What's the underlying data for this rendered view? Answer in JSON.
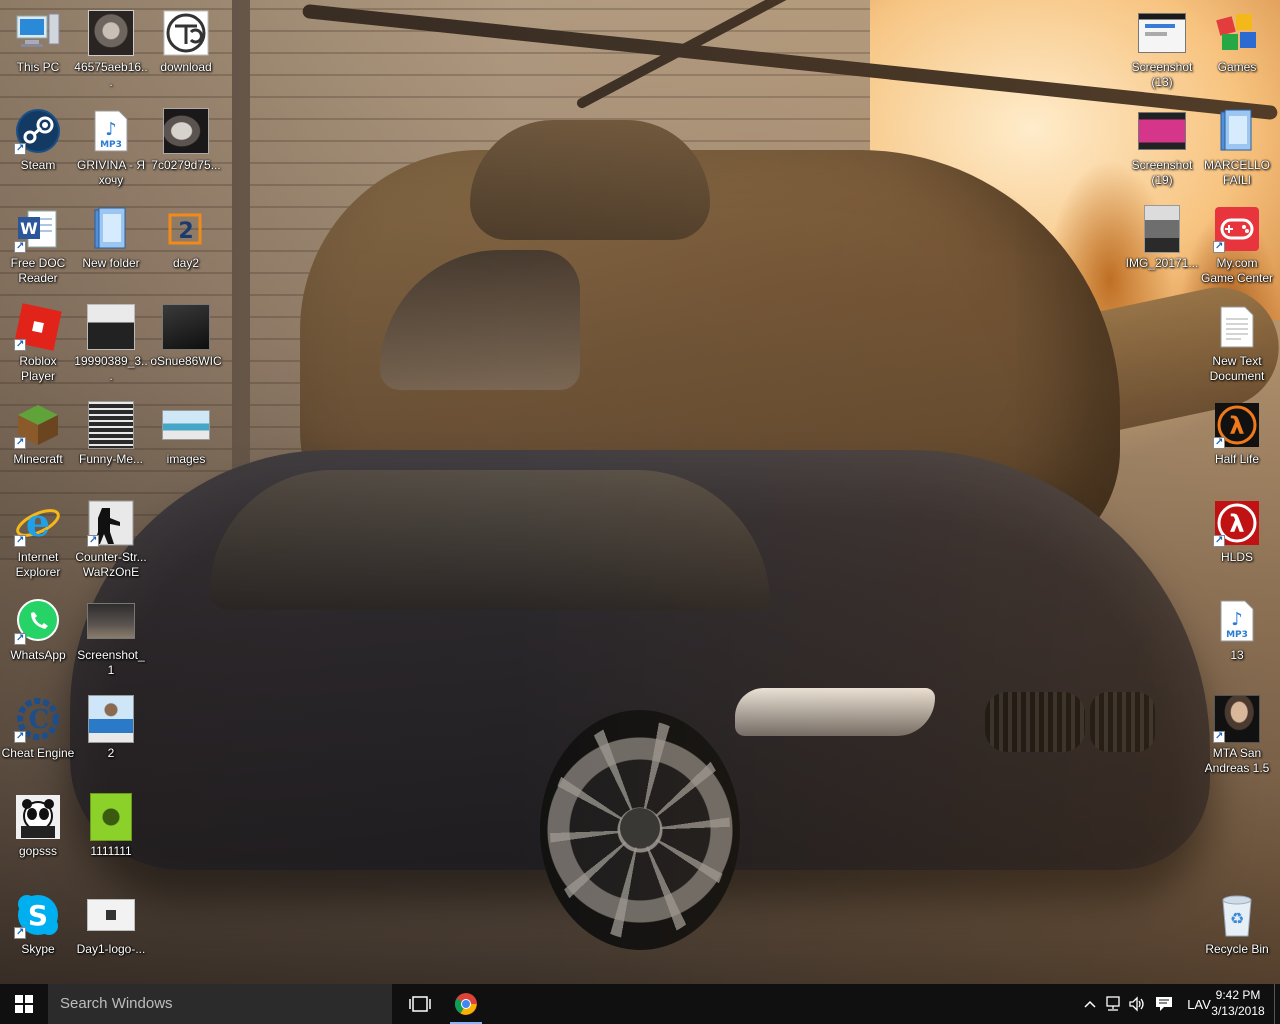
{
  "desktop": {
    "icons": [
      {
        "id": "this-pc",
        "label": "This PC",
        "icon": "computer-icon",
        "shortcut": false
      },
      {
        "id": "img-46575",
        "label": "46575aeb16...",
        "icon": "image-thumbnail-icon",
        "shortcut": false
      },
      {
        "id": "download",
        "label": "download",
        "icon": "image-thumbnail-icon",
        "shortcut": false
      },
      {
        "id": "steam",
        "label": "Steam",
        "icon": "steam-icon",
        "shortcut": true
      },
      {
        "id": "grivina",
        "label": "GRIVINA - Я хочу",
        "icon": "mp3-file-icon",
        "shortcut": false
      },
      {
        "id": "img-7c02",
        "label": "7c0279d75...",
        "icon": "image-thumbnail-icon",
        "shortcut": false
      },
      {
        "id": "free-doc",
        "label": "Free DOC Reader",
        "icon": "word-document-icon",
        "shortcut": true
      },
      {
        "id": "new-folder",
        "label": "New folder",
        "icon": "folder-icon",
        "shortcut": false
      },
      {
        "id": "day2",
        "label": "day2",
        "icon": "image-thumbnail-icon",
        "shortcut": false
      },
      {
        "id": "roblox",
        "label": "Roblox Player",
        "icon": "roblox-icon",
        "shortcut": true
      },
      {
        "id": "img-1999",
        "label": "19990389_3...",
        "icon": "image-thumbnail-icon",
        "shortcut": false
      },
      {
        "id": "osnue",
        "label": "oSnue86WIC",
        "icon": "image-thumbnail-icon",
        "shortcut": false
      },
      {
        "id": "minecraft",
        "label": "Minecraft",
        "icon": "minecraft-icon",
        "shortcut": true
      },
      {
        "id": "funny-me",
        "label": "Funny-Me...",
        "icon": "image-thumbnail-icon",
        "shortcut": false
      },
      {
        "id": "images",
        "label": "images",
        "icon": "image-thumbnail-icon",
        "shortcut": false
      },
      {
        "id": "ie",
        "label": "Internet Explorer",
        "icon": "internet-explorer-icon",
        "shortcut": true
      },
      {
        "id": "counter-strike",
        "label": "Counter-Str... WaRzOnE",
        "icon": "counter-strike-icon",
        "shortcut": true
      },
      {
        "id": "whatsapp",
        "label": "WhatsApp",
        "icon": "whatsapp-icon",
        "shortcut": true
      },
      {
        "id": "screenshot-1",
        "label": "Screenshot_1",
        "icon": "image-thumbnail-icon",
        "shortcut": false
      },
      {
        "id": "cheat-engine",
        "label": "Cheat Engine",
        "icon": "cheat-engine-icon",
        "shortcut": true
      },
      {
        "id": "img-2",
        "label": "2",
        "icon": "image-thumbnail-icon",
        "shortcut": false
      },
      {
        "id": "gopsss",
        "label": "gopsss",
        "icon": "image-thumbnail-icon",
        "shortcut": false
      },
      {
        "id": "img-1111111",
        "label": "1111111",
        "icon": "image-thumbnail-icon",
        "shortcut": false
      },
      {
        "id": "skype",
        "label": "Skype",
        "icon": "skype-icon",
        "shortcut": true
      },
      {
        "id": "day1-logo",
        "label": "Day1-logo-...",
        "icon": "image-thumbnail-icon",
        "shortcut": false
      },
      {
        "id": "screenshot-13",
        "label": "Screenshot (13)",
        "icon": "image-thumbnail-icon",
        "shortcut": false
      },
      {
        "id": "games",
        "label": "Games",
        "icon": "games-icon",
        "shortcut": false
      },
      {
        "id": "screenshot-19",
        "label": "Screenshot (19)",
        "icon": "image-thumbnail-icon",
        "shortcut": false
      },
      {
        "id": "marcello",
        "label": "MARCELLO FAILI",
        "icon": "folder-icon",
        "shortcut": false
      },
      {
        "id": "img-2017",
        "label": "IMG_20171...",
        "icon": "image-thumbnail-icon",
        "shortcut": false
      },
      {
        "id": "mycom",
        "label": "My.com Game Center",
        "icon": "mycom-game-center-icon",
        "shortcut": true
      },
      {
        "id": "new-text",
        "label": "New Text Document",
        "icon": "text-document-icon",
        "shortcut": false
      },
      {
        "id": "half-life",
        "label": "Half Life",
        "icon": "half-life-icon",
        "shortcut": true
      },
      {
        "id": "hlds",
        "label": "HLDS",
        "icon": "half-life-icon",
        "shortcut": true
      },
      {
        "id": "mp3-13",
        "label": "13",
        "icon": "mp3-file-icon",
        "shortcut": false
      },
      {
        "id": "mta",
        "label": "MTA San Andreas 1.5",
        "icon": "mta-san-andreas-icon",
        "shortcut": true
      },
      {
        "id": "recycle-bin",
        "label": "Recycle Bin",
        "icon": "recycle-bin-icon",
        "shortcut": false
      }
    ]
  },
  "taskbar": {
    "search_placeholder": "Search Windows",
    "start_icon": "windows-logo-icon",
    "task_view_icon": "task-view-icon",
    "pinned": [
      {
        "name": "Google Chrome",
        "icon": "chrome-icon",
        "active": true
      }
    ],
    "tray": {
      "chevron_icon": "chevron-up-icon",
      "network_icon": "network-icon",
      "volume_icon": "speaker-icon",
      "notifications_icon": "action-center-icon",
      "language": "LAV",
      "time": "9:42 PM",
      "date": "3/13/2018"
    }
  },
  "colors": {
    "taskbar_bg": "#101010",
    "search_bg": "#2b2b2b",
    "accent": "#1a5fb4"
  }
}
